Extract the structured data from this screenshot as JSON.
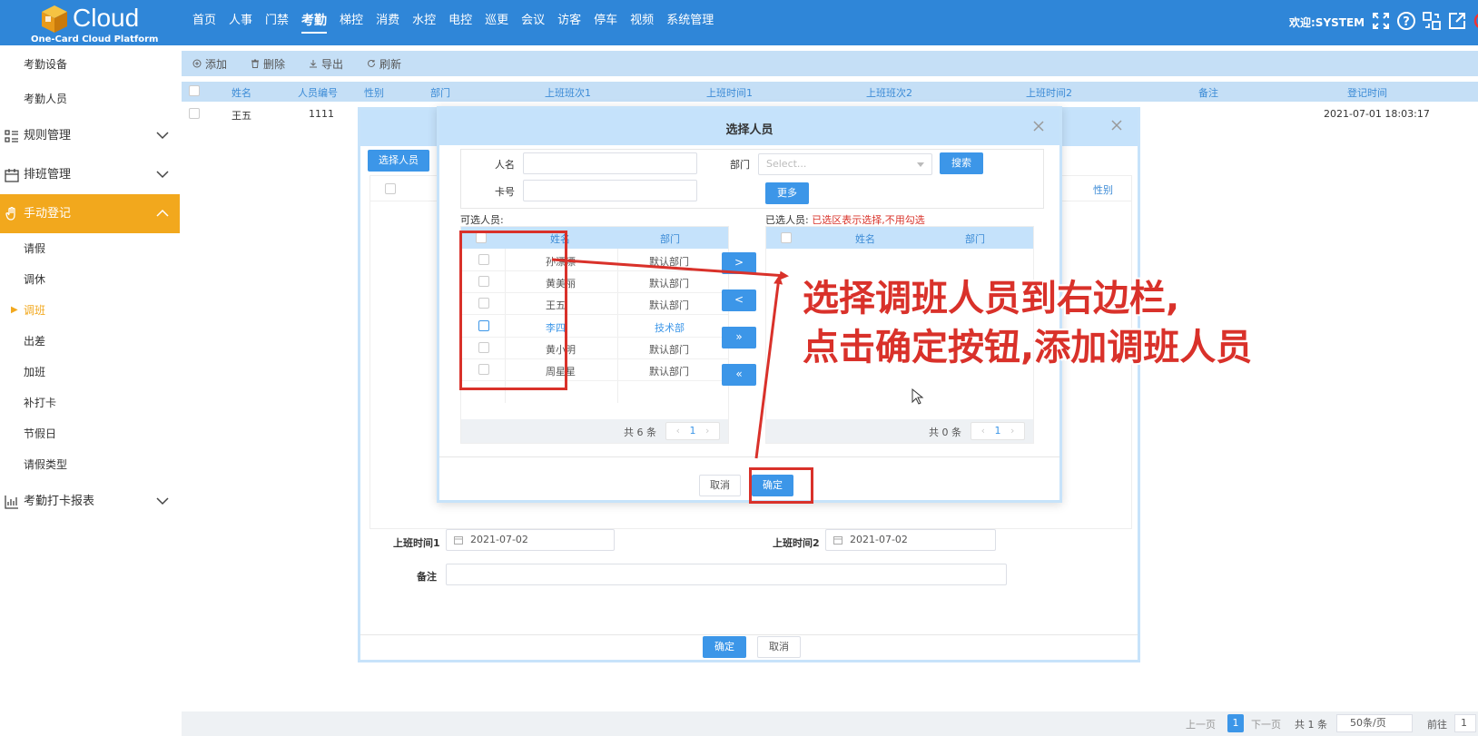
{
  "brand": {
    "name": "Cloud",
    "subtitle": "One-Card Cloud Platform"
  },
  "nav": {
    "items": [
      "首页",
      "人事",
      "门禁",
      "考勤",
      "梯控",
      "消费",
      "水控",
      "电控",
      "巡更",
      "会议",
      "访客",
      "停车",
      "视频",
      "系统管理"
    ],
    "active": "考勤",
    "welcome": "欢迎:SYSTEM"
  },
  "top_icons": [
    "fullscreen-icon",
    "help-icon",
    "switch-icon",
    "external-link-icon",
    "power-icon"
  ],
  "sidebar": {
    "top_subitems": [
      "考勤设备",
      "考勤人员"
    ],
    "groups": [
      {
        "label": "规则管理",
        "icon": "list-icon"
      },
      {
        "label": "排班管理",
        "icon": "calendar-icon"
      },
      {
        "label": "手动登记",
        "icon": "hand-icon",
        "active": true
      },
      {
        "label": "考勤打卡报表",
        "icon": "chart-icon"
      }
    ],
    "manual_items": [
      "请假",
      "调休",
      "调班",
      "出差",
      "加班",
      "补打卡",
      "节假日",
      "请假类型"
    ],
    "current": "调班"
  },
  "toolbar": {
    "add": "添加",
    "delete": "删除",
    "export": "导出",
    "refresh": "刷新"
  },
  "grid": {
    "columns": [
      "姓名",
      "人员编号",
      "性别",
      "部门",
      "上班班次1",
      "上班时间1",
      "上班班次2",
      "上班时间2",
      "备注",
      "登记时间"
    ],
    "row": {
      "name": "王五",
      "id": "1111",
      "time": "2021-07-01 18:03:17"
    }
  },
  "pager": {
    "prev": "上一页",
    "page": "1",
    "next": "下一页",
    "total": "共 1 条",
    "size": "50条/页",
    "goto": "前往",
    "goto_val": "1"
  },
  "outer_dialog": {
    "select_btn": "选择人员",
    "col_gender": "性别",
    "time1_label": "上班时间1",
    "time1_value": "2021-07-02",
    "time2_label": "上班时间2",
    "time2_value": "2021-07-02",
    "note_label": "备注",
    "ok": "确定",
    "cancel": "取消"
  },
  "inner_dialog": {
    "title": "选择人员",
    "name_label": "人名",
    "card_label": "卡号",
    "dept_label": "部门",
    "dept_placeholder": "Select...",
    "search_btn": "搜索",
    "more_btn": "更多",
    "available_label": "可选人员:",
    "selected_label": "已选人员:",
    "selected_note": "已选区表示选择,不用勾选",
    "col_name": "姓名",
    "col_dept": "部门",
    "available": [
      {
        "name": "孙漂漂",
        "dept": "默认部门"
      },
      {
        "name": "黄美丽",
        "dept": "默认部门"
      },
      {
        "name": "王五",
        "dept": "默认部门"
      },
      {
        "name": "李四",
        "dept": "技术部",
        "highlight": true
      },
      {
        "name": "黄小明",
        "dept": "默认部门"
      },
      {
        "name": "周星星",
        "dept": "默认部门"
      }
    ],
    "available_total": "共 6 条",
    "selected_total": "共 0 条",
    "page": "1",
    "arrows": [
      ">",
      "<",
      "»",
      "«"
    ],
    "cancel": "取消",
    "ok": "确定"
  },
  "annotation": {
    "line1": "选择调班人员到右边栏,",
    "line2": "点击确定按钮,添加调班人员",
    "color": "#d9312a"
  }
}
